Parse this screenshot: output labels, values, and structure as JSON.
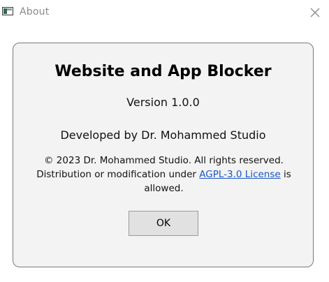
{
  "window": {
    "title": "About",
    "app_icon": "window-app-icon",
    "close_icon": "close-icon"
  },
  "about": {
    "app_name": "Website and App Blocker",
    "version": "Version 1.0.0",
    "developer": "Developed by Dr. Mohammed Studio",
    "copyright": "© 2023 Dr. Mohammed Studio. All rights reserved.",
    "license_prefix": "Distribution or modification under ",
    "license_link": "AGPL-3.0 License",
    "license_suffix": " is allowed.",
    "ok_label": "OK"
  },
  "colors": {
    "link": "#1a56c4",
    "panel_bg": "#f3f3f3",
    "button_bg": "#e1e1e1"
  }
}
